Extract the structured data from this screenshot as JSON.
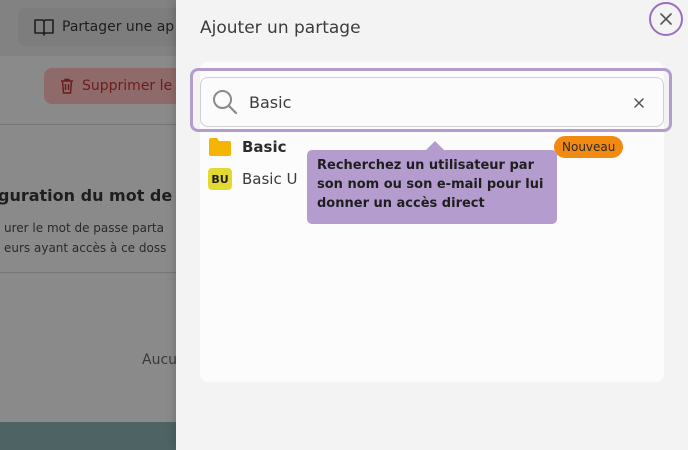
{
  "background": {
    "share_button_label": "Partager une ap",
    "delete_button_label": "Supprimer le",
    "section_title": "guration du mot de",
    "description_line1": "urer le mot de passe parta",
    "description_line2": "eurs ayant accès à ce doss",
    "empty_text": "Aucu"
  },
  "panel": {
    "title": "Ajouter un partage",
    "close_icon": "close-icon"
  },
  "search": {
    "value": "Basic",
    "icon": "search-icon",
    "clear_icon": "clear-icon"
  },
  "results": {
    "folder": {
      "name": "Basic",
      "icon": "folder-icon",
      "color": "#f5b400"
    },
    "user": {
      "initials": "BU",
      "name": "Basic U"
    }
  },
  "badge": {
    "label": "Nouveau",
    "color": "#f28a12"
  },
  "tooltip": {
    "line1": "Recherchez un utilisateur par",
    "line2": "son nom ou son e-mail pour lui",
    "line3": "donner un accès direct"
  }
}
